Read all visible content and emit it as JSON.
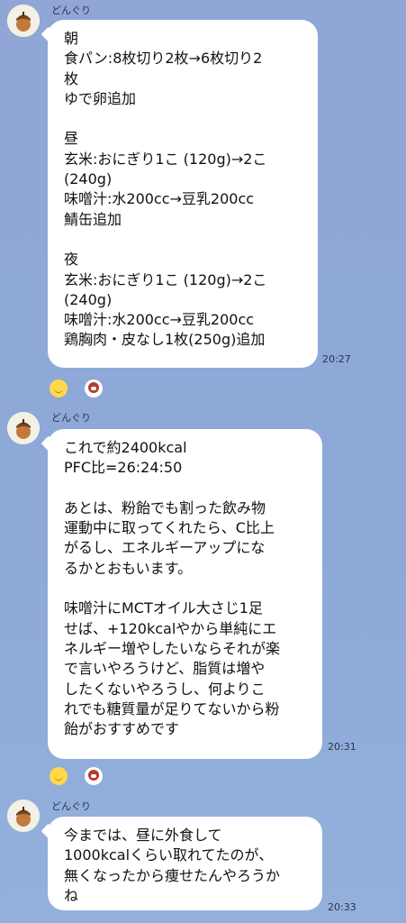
{
  "messages": [
    {
      "sender": "どんぐり",
      "time": "20:27",
      "lines": [
        "朝",
        "食パン:8枚切り2枚→6枚切り2",
        "枚",
        "ゆで卵追加",
        "",
        "昼",
        "玄米:おにぎり1こ (120g)→2こ",
        "(240g)",
        "味噌汁:水200cc→豆乳200cc",
        "鯖缶追加",
        "",
        "夜",
        "玄米:おにぎり1こ (120g)→2こ",
        "(240g)",
        "味噌汁:水200cc→豆乳200cc",
        "鶏胸肉・皮なし1枚(250g)追加"
      ]
    },
    {
      "sender": "どんぐり",
      "time": "20:31",
      "lines": [
        "これで約2400kcal",
        "PFC比=26:24:50",
        "",
        "あとは、粉飴でも割った飲み物",
        "運動中に取ってくれたら、C比上",
        "がるし、エネルギーアップにな",
        "るかとおもいます。",
        "",
        "味噌汁にMCTオイル大さじ1足",
        "せば、+120kcalやから単純にエ",
        "ネルギー増やしたいならそれが楽",
        "で言いやろうけど、脂質は増や",
        "したくないやろうし、何よりこ",
        "れでも糖質量が足りてないから粉",
        "飴がおすすめです"
      ]
    },
    {
      "sender": "どんぐり",
      "time": "20:33",
      "lines": [
        "今までは、昼に外食して",
        "1000kcalくらい取れてたのが、",
        "無くなったから痩せたんやろうか",
        "ね"
      ]
    }
  ],
  "reactions": [
    {
      "icons": [
        "smile-emoji-icon",
        "heart-sticker-icon"
      ]
    },
    {
      "icons": [
        "smile-emoji-icon",
        "heart-sticker-icon"
      ]
    }
  ],
  "colors": {
    "background": "#8fa6d6",
    "bubble": "#ffffff"
  }
}
